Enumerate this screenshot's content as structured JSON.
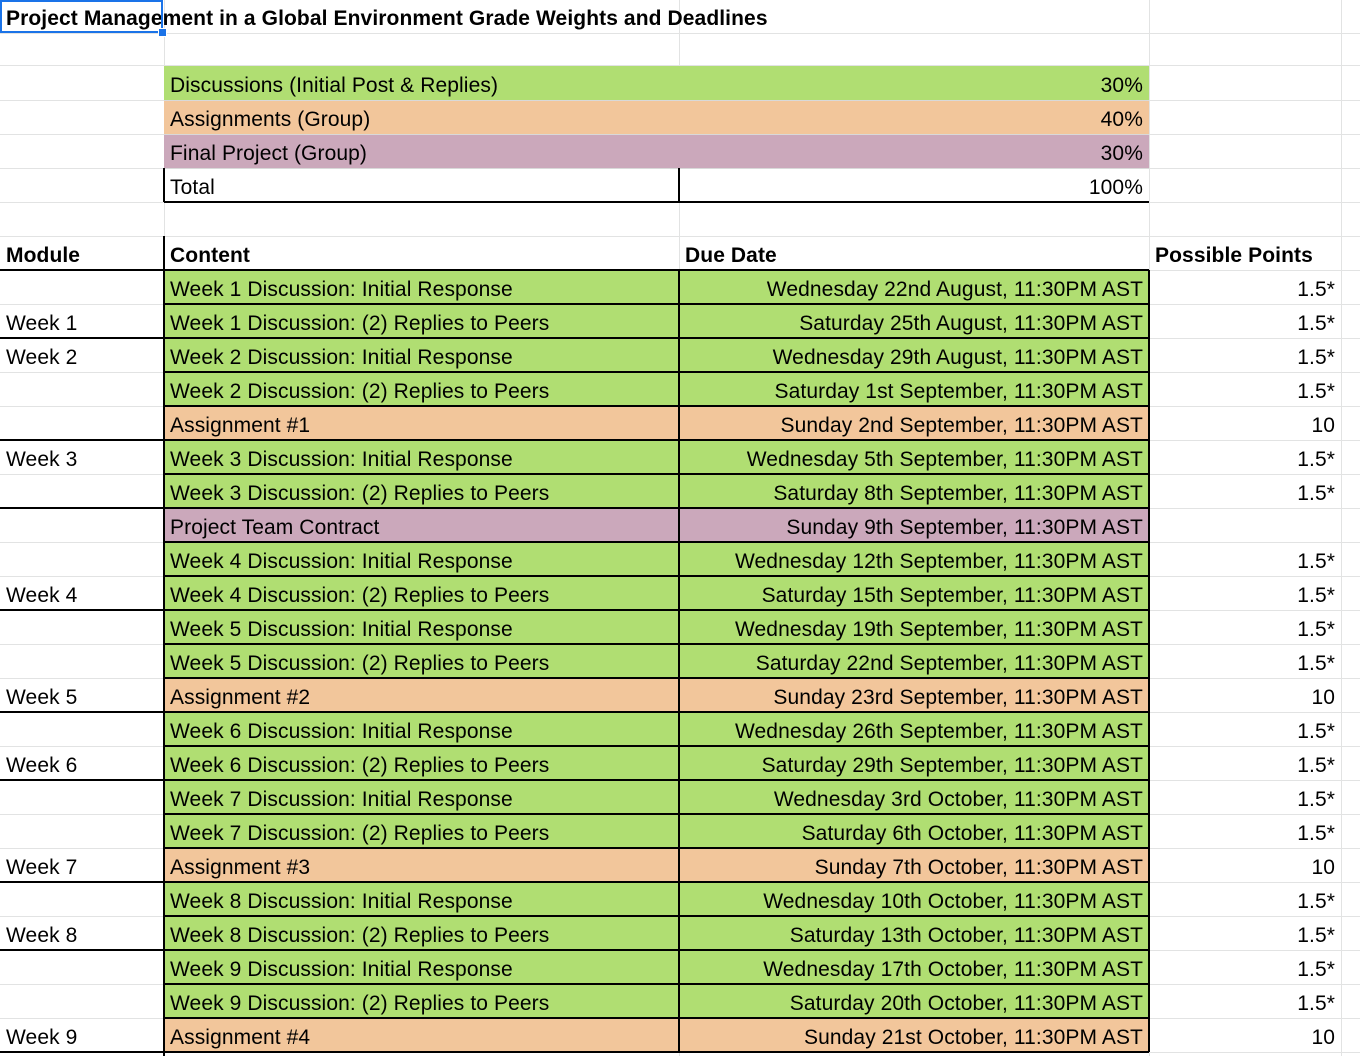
{
  "title": "Project Management in a Global Environment Grade Weights and Deadlines",
  "colors": {
    "green": "#b0de72",
    "orange": "#f2c69b",
    "purple": "#cba8bb",
    "selection": "#1a73e8",
    "gridline": "#e2e3e3"
  },
  "weights": [
    {
      "label": "Discussions (Initial Post & Replies)",
      "value": "30%",
      "color": "green"
    },
    {
      "label": "Assignments (Group)",
      "value": "40%",
      "color": "orange"
    },
    {
      "label": "Final Project (Group)",
      "value": "30%",
      "color": "purple"
    },
    {
      "label": "Total",
      "value": "100%",
      "color": "white"
    }
  ],
  "headers": {
    "module": "Module",
    "content": "Content",
    "due": "Due Date",
    "points": "Possible Points"
  },
  "rows": [
    {
      "module": "",
      "content": "Week 1 Discussion: Initial Response",
      "due": "Wednesday 22nd August, 11:30PM AST",
      "points": "1.5*",
      "color": "green"
    },
    {
      "module": "Week 1",
      "content": "Week 1 Discussion: (2) Replies to Peers",
      "due": "Saturday 25th August, 11:30PM AST",
      "points": "1.5*",
      "color": "green"
    },
    {
      "module": "Week 2",
      "content": "Week 2 Discussion: Initial Response",
      "due": "Wednesday 29th August, 11:30PM AST",
      "points": "1.5*",
      "color": "green"
    },
    {
      "module": "",
      "content": "Week 2 Discussion: (2) Replies to Peers",
      "due": "Saturday 1st September, 11:30PM AST",
      "points": "1.5*",
      "color": "green"
    },
    {
      "module": "",
      "content": "Assignment #1",
      "due": "Sunday 2nd September, 11:30PM AST",
      "points": "10",
      "color": "orange"
    },
    {
      "module": "Week 3",
      "content": "Week 3 Discussion: Initial Response",
      "due": "Wednesday 5th September, 11:30PM AST",
      "points": "1.5*",
      "color": "green"
    },
    {
      "module": "",
      "content": "Week 3 Discussion: (2) Replies to Peers",
      "due": "Saturday 8th September, 11:30PM AST",
      "points": "1.5*",
      "color": "green"
    },
    {
      "module": "",
      "content": "Project Team Contract",
      "due": "Sunday 9th September, 11:30PM AST",
      "points": "",
      "color": "purple"
    },
    {
      "module": "",
      "content": "Week 4 Discussion: Initial Response",
      "due": "Wednesday 12th September, 11:30PM AST",
      "points": "1.5*",
      "color": "green"
    },
    {
      "module": "Week 4",
      "content": "Week 4 Discussion: (2) Replies to Peers",
      "due": "Saturday 15th September, 11:30PM AST",
      "points": "1.5*",
      "color": "green"
    },
    {
      "module": "",
      "content": "Week 5 Discussion: Initial Response",
      "due": "Wednesday 19th September, 11:30PM AST",
      "points": "1.5*",
      "color": "green"
    },
    {
      "module": "",
      "content": "Week 5 Discussion: (2) Replies to Peers",
      "due": "Saturday 22nd September, 11:30PM AST",
      "points": "1.5*",
      "color": "green"
    },
    {
      "module": "Week 5",
      "content": "Assignment #2",
      "due": "Sunday 23rd September, 11:30PM AST",
      "points": "10",
      "color": "orange"
    },
    {
      "module": "",
      "content": "Week 6 Discussion: Initial Response",
      "due": "Wednesday 26th September, 11:30PM AST",
      "points": "1.5*",
      "color": "green"
    },
    {
      "module": "Week 6",
      "content": "Week 6 Discussion: (2) Replies to Peers",
      "due": "Saturday 29th September, 11:30PM AST",
      "points": "1.5*",
      "color": "green"
    },
    {
      "module": "",
      "content": "Week 7 Discussion: Initial Response",
      "due": "Wednesday 3rd October, 11:30PM AST",
      "points": "1.5*",
      "color": "green"
    },
    {
      "module": "",
      "content": "Week 7 Discussion: (2) Replies to Peers",
      "due": "Saturday 6th October, 11:30PM AST",
      "points": "1.5*",
      "color": "green"
    },
    {
      "module": "Week 7",
      "content": "Assignment #3",
      "due": "Sunday 7th October, 11:30PM AST",
      "points": "10",
      "color": "orange"
    },
    {
      "module": "",
      "content": "Week 8 Discussion: Initial Response",
      "due": "Wednesday 10th October, 11:30PM AST",
      "points": "1.5*",
      "color": "green"
    },
    {
      "module": "Week 8",
      "content": "Week 8 Discussion: (2) Replies to Peers",
      "due": "Saturday 13th October, 11:30PM AST",
      "points": "1.5*",
      "color": "green"
    },
    {
      "module": "",
      "content": "Week 9 Discussion: Initial Response",
      "due": "Wednesday 17th October, 11:30PM AST",
      "points": "1.5*",
      "color": "green"
    },
    {
      "module": "",
      "content": "Week 9 Discussion: (2) Replies to Peers",
      "due": "Saturday 20th October, 11:30PM AST",
      "points": "1.5*",
      "color": "green"
    },
    {
      "module": "Week 9",
      "content": "Assignment #4",
      "due": "Sunday 21st October, 11:30PM AST",
      "points": "10",
      "color": "orange"
    }
  ]
}
